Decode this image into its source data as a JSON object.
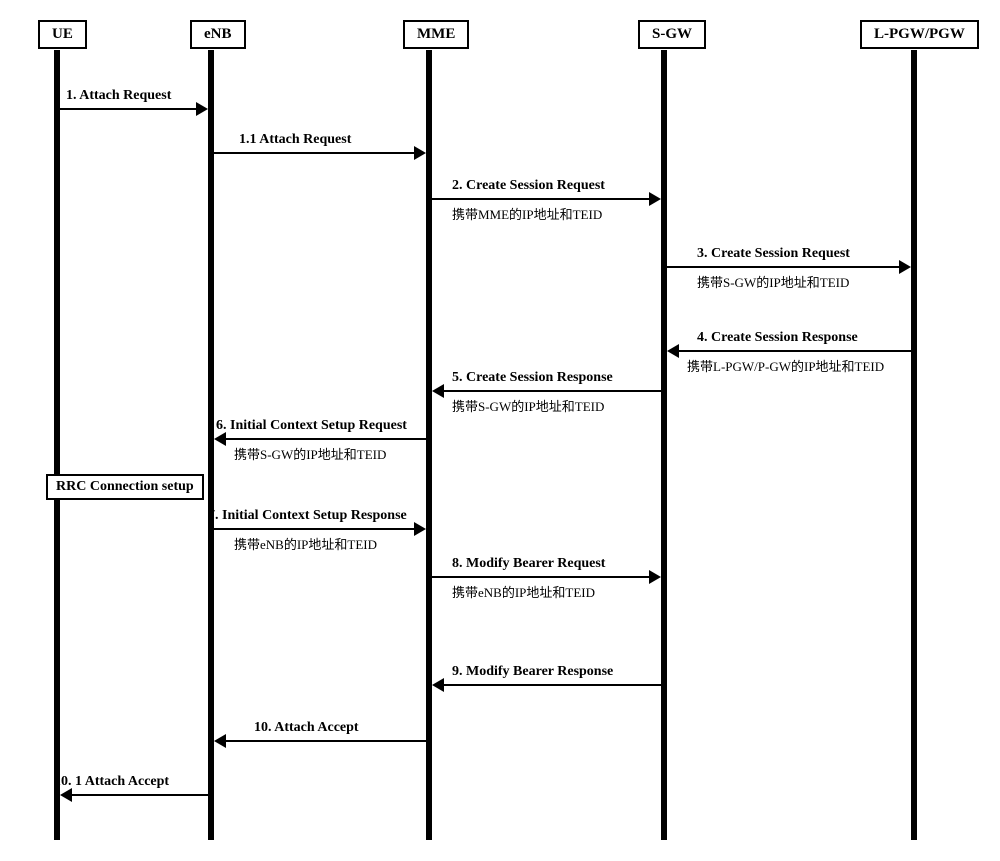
{
  "actors": {
    "ue": "UE",
    "enb": "eNB",
    "mme": "MME",
    "sgw": "S-GW",
    "lpgw": "L-PGW/PGW"
  },
  "messages": {
    "m1": {
      "label": "1. Attach Request",
      "sub": ""
    },
    "m1_1": {
      "label": "1.1 Attach Request",
      "sub": ""
    },
    "m2": {
      "label": "2. Create Session Request",
      "sub": "携带MME的IP地址和TEID"
    },
    "m3": {
      "label": "3. Create Session Request",
      "sub": "携带S-GW的IP地址和TEID"
    },
    "m4": {
      "label": "4. Create Session Response",
      "sub": "携带L-PGW/P-GW的IP地址和TEID"
    },
    "m5": {
      "label": "5. Create Session Response",
      "sub": "携带S-GW的IP地址和TEID"
    },
    "m6": {
      "label": "6. Initial Context Setup Request",
      "sub": "携带S-GW的IP地址和TEID"
    },
    "note": "RRC Connection setup",
    "m7": {
      "label": "7. Initial Context Setup Response",
      "sub": "携带eNB的IP地址和TEID"
    },
    "m8": {
      "label": "8. Modify Bearer Request",
      "sub": "携带eNB的IP地址和TEID"
    },
    "m9": {
      "label": "9. Modify Bearer Response",
      "sub": ""
    },
    "m10": {
      "label": "10. Attach Accept",
      "sub": ""
    },
    "m10_1": {
      "label": "10. 1 Attach Accept",
      "sub": ""
    }
  },
  "chart_data": {
    "type": "table",
    "description": "UML sequence diagram of LTE attach procedure between UE, eNB, MME, S-GW and L-PGW/PGW",
    "actors": [
      "UE",
      "eNB",
      "MME",
      "S-GW",
      "L-PGW/PGW"
    ],
    "messages": [
      {
        "step": "1",
        "from": "UE",
        "to": "eNB",
        "name": "Attach Request"
      },
      {
        "step": "1.1",
        "from": "eNB",
        "to": "MME",
        "name": "Attach Request"
      },
      {
        "step": "2",
        "from": "MME",
        "to": "S-GW",
        "name": "Create Session Request",
        "note": "携带MME的IP地址和TEID"
      },
      {
        "step": "3",
        "from": "S-GW",
        "to": "L-PGW/PGW",
        "name": "Create Session Request",
        "note": "携带S-GW的IP地址和TEID"
      },
      {
        "step": "4",
        "from": "L-PGW/PGW",
        "to": "S-GW",
        "name": "Create Session Response",
        "note": "携带L-PGW/P-GW的IP地址和TEID"
      },
      {
        "step": "5",
        "from": "S-GW",
        "to": "MME",
        "name": "Create Session Response",
        "note": "携带S-GW的IP地址和TEID"
      },
      {
        "step": "6",
        "from": "MME",
        "to": "eNB",
        "name": "Initial Context Setup Request",
        "note": "携带S-GW的IP地址和TEID"
      },
      {
        "step": "note",
        "from": "UE",
        "to": "eNB",
        "name": "RRC Connection setup"
      },
      {
        "step": "7",
        "from": "eNB",
        "to": "MME",
        "name": "Initial Context Setup Response",
        "note": "携带eNB的IP地址和TEID"
      },
      {
        "step": "8",
        "from": "MME",
        "to": "S-GW",
        "name": "Modify Bearer Request",
        "note": "携带eNB的IP地址和TEID"
      },
      {
        "step": "9",
        "from": "S-GW",
        "to": "MME",
        "name": "Modify Bearer Response"
      },
      {
        "step": "10",
        "from": "MME",
        "to": "eNB",
        "name": "Attach Accept"
      },
      {
        "step": "10.1",
        "from": "eNB",
        "to": "UE",
        "name": "Attach Accept"
      }
    ]
  }
}
